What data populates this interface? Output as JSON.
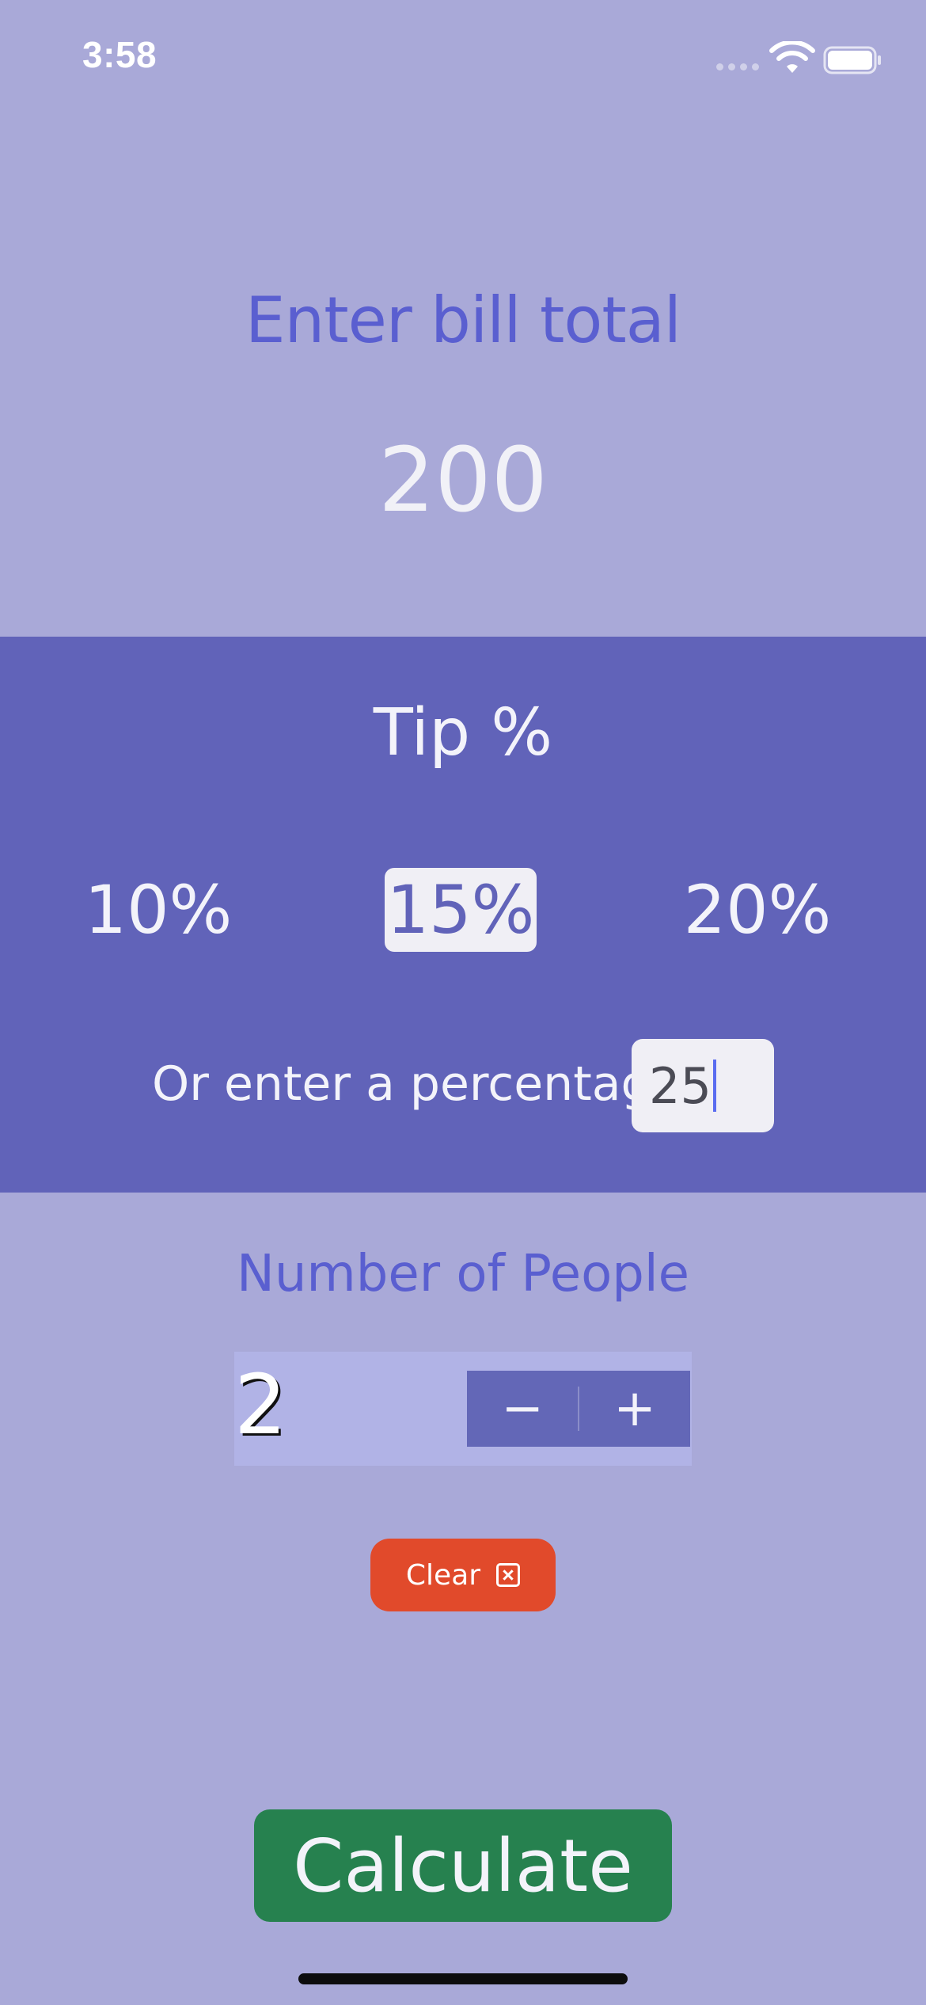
{
  "status_bar": {
    "time": "3:58",
    "signal_icon": "cellular-signal-dots",
    "wifi_icon": "wifi-icon",
    "battery_icon": "battery-full-icon"
  },
  "bill": {
    "title": "Enter bill total",
    "value": "200"
  },
  "tip": {
    "title": "Tip %",
    "options": [
      "10%",
      "15%",
      "20%"
    ],
    "selected": "15%",
    "custom_label": "Or enter a percentage:",
    "custom_value": "25"
  },
  "people": {
    "title": "Number of People",
    "count": "2",
    "decrement_label": "−",
    "increment_label": "+"
  },
  "clear": {
    "label": "Clear",
    "icon": "close-box-icon"
  },
  "calculate": {
    "label": "Calculate"
  },
  "colors": {
    "background": "#a9a9d8",
    "tip_band": "#6163b9",
    "heading_accent": "#5a5fd0",
    "clear_button": "#e14a2b",
    "calculate_button": "#26814f",
    "selected_option_bg": "#f0eff5"
  }
}
